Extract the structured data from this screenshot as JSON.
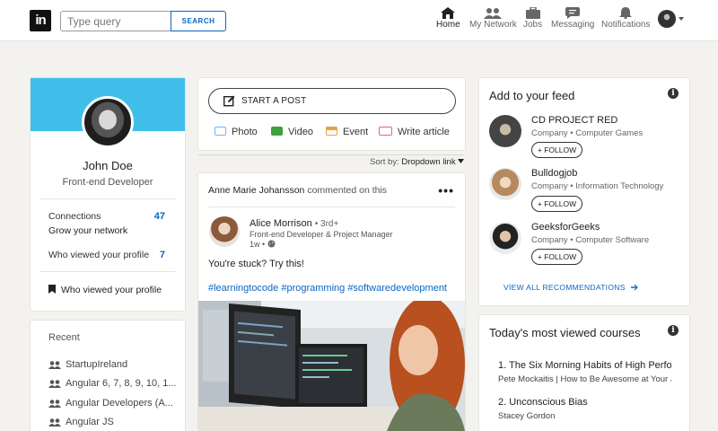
{
  "header": {
    "logo_text": "in",
    "search": {
      "placeholder": "Type query",
      "button_label": "SEARCH"
    },
    "nav": [
      {
        "label": "Home",
        "icon": "home-icon",
        "active": true
      },
      {
        "label": "My Network",
        "icon": "network-icon",
        "active": false
      },
      {
        "label": "Jobs",
        "icon": "briefcase-icon",
        "active": false
      },
      {
        "label": "Messaging",
        "icon": "message-icon",
        "active": false
      },
      {
        "label": "Notifications",
        "icon": "bell-icon",
        "active": false
      }
    ]
  },
  "profile": {
    "name": "John Doe",
    "title": "Front-end Developer",
    "connections_label": "Connections",
    "connections_count": "47",
    "grow_label": "Grow your network",
    "viewed_label": "Who viewed your profile",
    "viewed_count": "7",
    "bookmark_label": "Who viewed your profile"
  },
  "recent": {
    "title": "Recent",
    "items": [
      "StartupIreland",
      "Angular 6, 7, 8, 9, 10, 1...",
      "Angular Developers (A...",
      "Angular JS"
    ]
  },
  "composer": {
    "start_post": "START A POST",
    "actions": [
      {
        "label": "Photo",
        "color": "#70b5f9"
      },
      {
        "label": "Video",
        "color": "#3ea13e"
      },
      {
        "label": "Event",
        "color": "#e7a33e"
      },
      {
        "label": "Write article",
        "color": "#e06a6a"
      }
    ]
  },
  "sort": {
    "label": "Sort by:",
    "value": "Dropdown link"
  },
  "feed_post": {
    "activity_actor": "Anne Marie Johansson",
    "activity_text": "commented on this",
    "author": "Alice Morrison",
    "degree": "• 3rd+",
    "author_title": "Front-end Developer & Project Manager",
    "time": "1w •",
    "text": "You're stuck? Try this!",
    "hashtags": "#learningtocode #programming #softwaredevelopment"
  },
  "add_to_feed": {
    "title": "Add to your feed",
    "follow_label": "+ FOLLOW",
    "items": [
      {
        "name": "CD PROJECT RED",
        "sub": "Company • Computer Games"
      },
      {
        "name": "Bulldogjob",
        "sub": "Company • Information Technology"
      },
      {
        "name": "GeeksforGeeks",
        "sub": "Company • Computer Software"
      }
    ],
    "view_all": "VIEW ALL RECOMMENDATIONS"
  },
  "courses": {
    "title": "Today's most viewed courses",
    "items": [
      {
        "title": "1. The Six Morning Habits of High Perfor",
        "sub": "Pete Mockaitis | How to Be Awesome at Your J"
      },
      {
        "title": "2. Unconscious Bias",
        "sub": "Stacey Gordon"
      }
    ]
  },
  "colors": {
    "accent": "#0a66c2",
    "banner": "#3fbfe9",
    "page_bg": "#f3f2ef"
  }
}
